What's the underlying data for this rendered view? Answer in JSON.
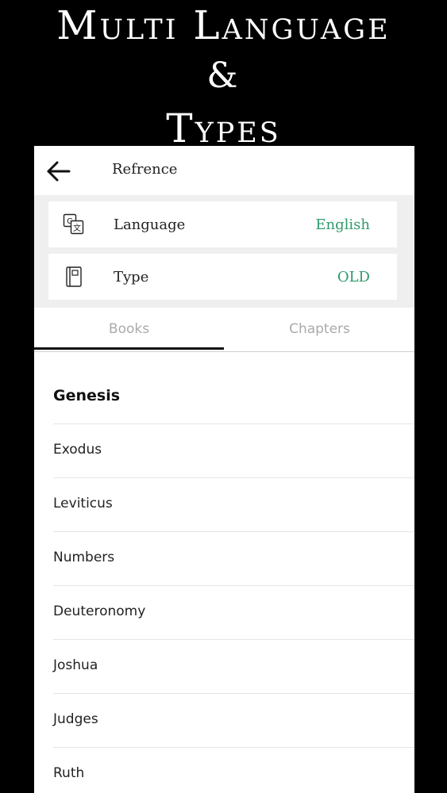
{
  "promo": {
    "line1": "Multi Language",
    "line2": "&",
    "line3": "Types"
  },
  "header": {
    "title": "Refrence",
    "back_icon": "arrow-left-icon"
  },
  "settings": {
    "language": {
      "icon": "translate-icon",
      "label": "Language",
      "value": "English"
    },
    "type": {
      "icon": "book-icon",
      "label": "Type",
      "value": "OLD"
    }
  },
  "tabs": [
    {
      "label": "Books",
      "selected": true
    },
    {
      "label": "Chapters",
      "selected": false
    }
  ],
  "books": [
    "Genesis",
    "Exodus",
    "Leviticus",
    "Numbers",
    "Deuteronomy",
    "Joshua",
    "Judges",
    "Ruth"
  ],
  "colors": {
    "accent": "#2e9b6b",
    "settings_bg": "#efefef",
    "promo_bg": "#000000"
  }
}
